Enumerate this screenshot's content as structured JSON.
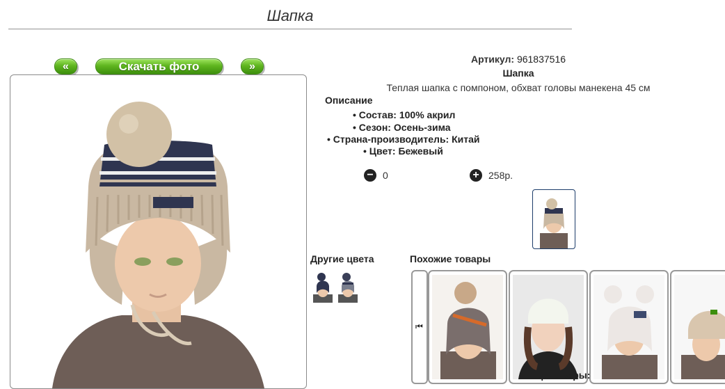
{
  "page": {
    "title": "Шапка"
  },
  "nav": {
    "prev_label": "«",
    "download_label": "Скачать фото",
    "next_label": "»"
  },
  "product": {
    "sku_label": "Артикул:",
    "sku_value": "961837516",
    "name": "Шапка",
    "description": "Теплая шапка с помпоном, обхват головы манекена 45 см",
    "details_heading": "Описание",
    "properties": [
      "Состав: 100% акрил",
      "Сезон: Осень-зима",
      "Страна-производитель: Китай",
      "Цвет: Бежевый"
    ],
    "quantity": "0",
    "price": "258р.",
    "colors": {
      "beige": "#c9b8a2",
      "navy": "#2f3550",
      "pompom": "#d2c1a6",
      "sweater": "#6e5e57"
    }
  },
  "related": {
    "other_colors_heading": "Другие цвета",
    "similar_heading": "Похожие товары",
    "more_label": "Ещё товары:"
  }
}
